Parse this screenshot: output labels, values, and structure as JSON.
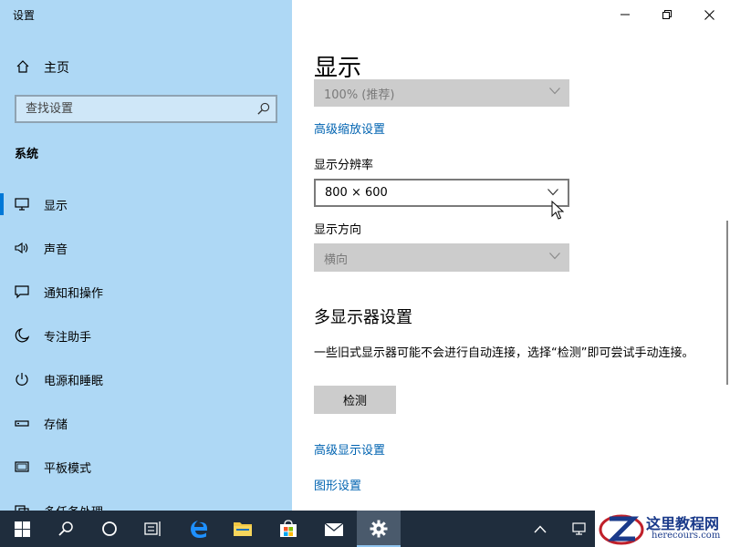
{
  "window": {
    "title": "设置"
  },
  "sidebar": {
    "home_label": "主页",
    "search_placeholder": "查找设置",
    "section_title": "系统",
    "items": [
      {
        "label": "显示",
        "icon": "monitor-icon",
        "active": true
      },
      {
        "label": "声音",
        "icon": "speaker-icon"
      },
      {
        "label": "通知和操作",
        "icon": "message-icon"
      },
      {
        "label": "专注助手",
        "icon": "moon-icon"
      },
      {
        "label": "电源和睡眠",
        "icon": "power-icon"
      },
      {
        "label": "存储",
        "icon": "storage-icon"
      },
      {
        "label": "平板模式",
        "icon": "tablet-icon"
      },
      {
        "label": "多任务处理",
        "icon": "multitask-icon"
      }
    ]
  },
  "main": {
    "title": "显示",
    "scale_value": "100% (推荐)",
    "advanced_scaling_link": "高级缩放设置",
    "resolution_label": "显示分辨率",
    "resolution_value": "800 × 600",
    "orientation_label": "显示方向",
    "orientation_value": "横向",
    "multi_display_heading": "多显示器设置",
    "multi_display_desc": "一些旧式显示器可能不会进行自动连接，选择“检测”即可尝试手动连接。",
    "detect_button": "检测",
    "advanced_display_link": "高级显示设置",
    "graphics_link": "图形设置"
  },
  "watermark": {
    "line1": "这里教程网",
    "line2": "herecours.com"
  },
  "colors": {
    "sidebar_bg": "#aed8f5",
    "accent": "#0078d7",
    "link": "#0063b1",
    "taskbar_bg": "#1f2d3d"
  }
}
